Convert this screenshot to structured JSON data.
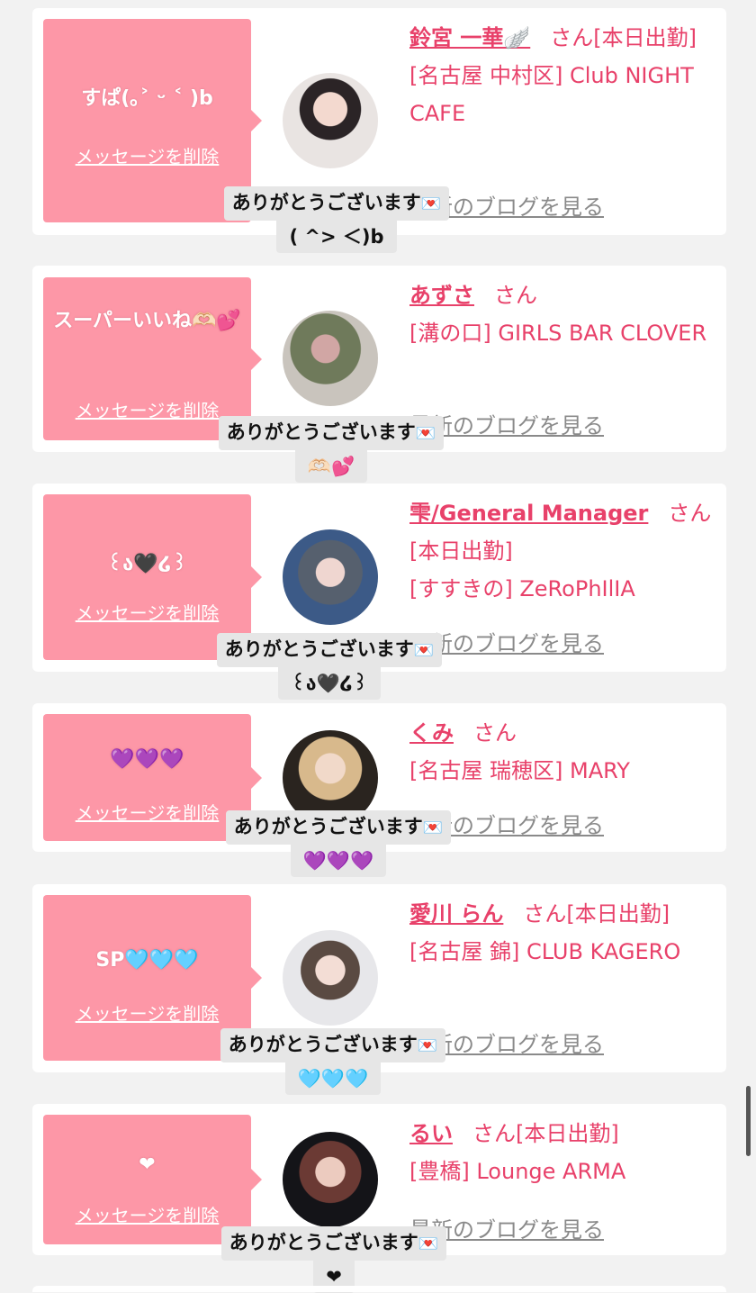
{
  "delete_label": "メッセージを削除",
  "blog_label": "最新のブログを見る",
  "honorific": "さん",
  "reply_prefix": "ありがとうございます",
  "envelope_icon": "💌",
  "colors": {
    "accent": "#e8416a",
    "message_box": "#fd97a7",
    "card": "#ffffff",
    "background": "#f2f2f2"
  },
  "cards": [
    {
      "message": "すぱ(｡˃ ᵕ ˂ )b",
      "name": "鈴宮 一華🪽",
      "after_san": "[本日出勤]",
      "lines": [
        "[名古屋 中村区] Club NIGHT CAFE"
      ],
      "reply_emoji": "( ^> ＜)b"
    },
    {
      "message": "スーパーいいね🫶🏻💕",
      "name": "あずさ",
      "after_san": "",
      "lines": [
        "[溝の口] GIRLS BAR CLOVER"
      ],
      "reply_emoji": "🫶🏻💕"
    },
    {
      "message": "꒰ა🖤໒꒱",
      "name": "雫/General Manager",
      "after_san": "",
      "lines": [
        "[本日出勤]",
        "[すすきの] ZeRoPhIlIA"
      ],
      "reply_emoji": "꒰ა🖤໒꒱"
    },
    {
      "message": "💜💜💜",
      "name": "くみ",
      "after_san": "",
      "lines": [
        "[名古屋 瑞穂区] MARY"
      ],
      "reply_emoji": "💜💜💜"
    },
    {
      "message": "SP🩵🩵🩵",
      "name": "愛川 らん",
      "after_san": "[本日出勤]",
      "lines": [
        "[名古屋 錦] CLUB KAGERO"
      ],
      "reply_emoji": "🩵🩵🩵"
    },
    {
      "message": "❤",
      "name": "るい",
      "after_san": "[本日出勤]",
      "lines": [
        "[豊橋] Lounge ARMA"
      ],
      "reply_emoji": "❤"
    }
  ]
}
